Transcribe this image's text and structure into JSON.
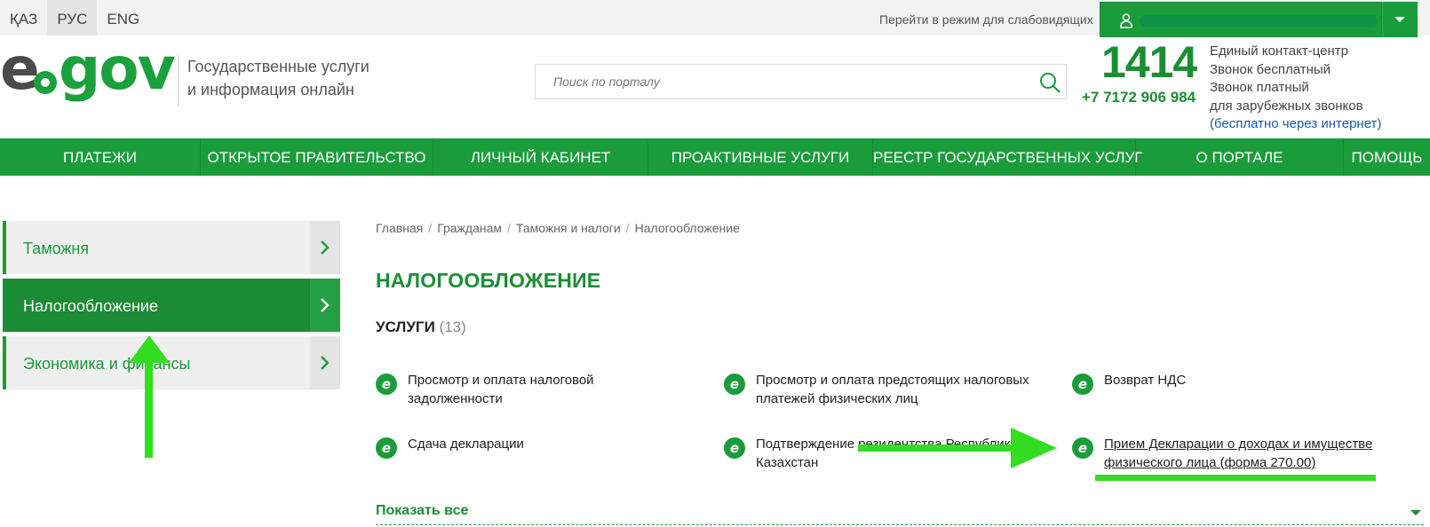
{
  "topbar": {
    "languages": [
      "ҚАЗ",
      "РУС",
      "ENG"
    ],
    "low_vision": "Перейти в режим для слабовидящих"
  },
  "header": {
    "tagline_line1": "Государственные услуги",
    "tagline_line2": "и информация онлайн",
    "search_placeholder": "Поиск по порталу",
    "phone_short": "1414",
    "phone_long": "+7 7172 906 984",
    "contact_lines": [
      "Единый контакт-центр",
      "Звонок бесплатный",
      "Звонок платный",
      "для зарубежных звонков"
    ],
    "contact_link": "(бесплатно через интернет)"
  },
  "nav": {
    "items": [
      "ПЛАТЕЖИ",
      "ОТКРЫТОЕ ПРАВИТЕЛЬСТВО",
      "ЛИЧНЫЙ КАБИНЕТ",
      "ПРОАКТИВНЫЕ УСЛУГИ",
      "РЕЕСТР ГОСУДАРСТВЕННЫХ УСЛУГ",
      "О ПОРТАЛЕ",
      "ПОМОЩЬ"
    ]
  },
  "sidebar": {
    "items": [
      {
        "label": "Таможня",
        "active": false
      },
      {
        "label": "Налогообложение",
        "active": true
      },
      {
        "label": "Экономика и финансы",
        "active": false
      }
    ]
  },
  "main": {
    "breadcrumb": [
      "Главная",
      "Гражданам",
      "Таможня и налоги",
      "Налогообложение"
    ],
    "title": "НАЛОГООБЛОЖЕНИЕ",
    "services_heading": "УСЛУГИ",
    "services_count": "(13)",
    "services": [
      "Просмотр и оплата налоговой задолженности",
      "Просмотр и оплата предстоящих налоговых платежей физических лиц",
      "Возврат НДС",
      "Сдача декларации",
      "Подтверждение резидентства Республики Казахстан",
      "Прием Декларации о доходах и имуществе физического лица (форма 270.00)"
    ],
    "service_icon_letter": "e",
    "show_all": "Показать все"
  },
  "colors": {
    "brand_green": "#1a9c3a",
    "dark_green": "#1b8b35",
    "annotation_green": "#33dd22"
  }
}
